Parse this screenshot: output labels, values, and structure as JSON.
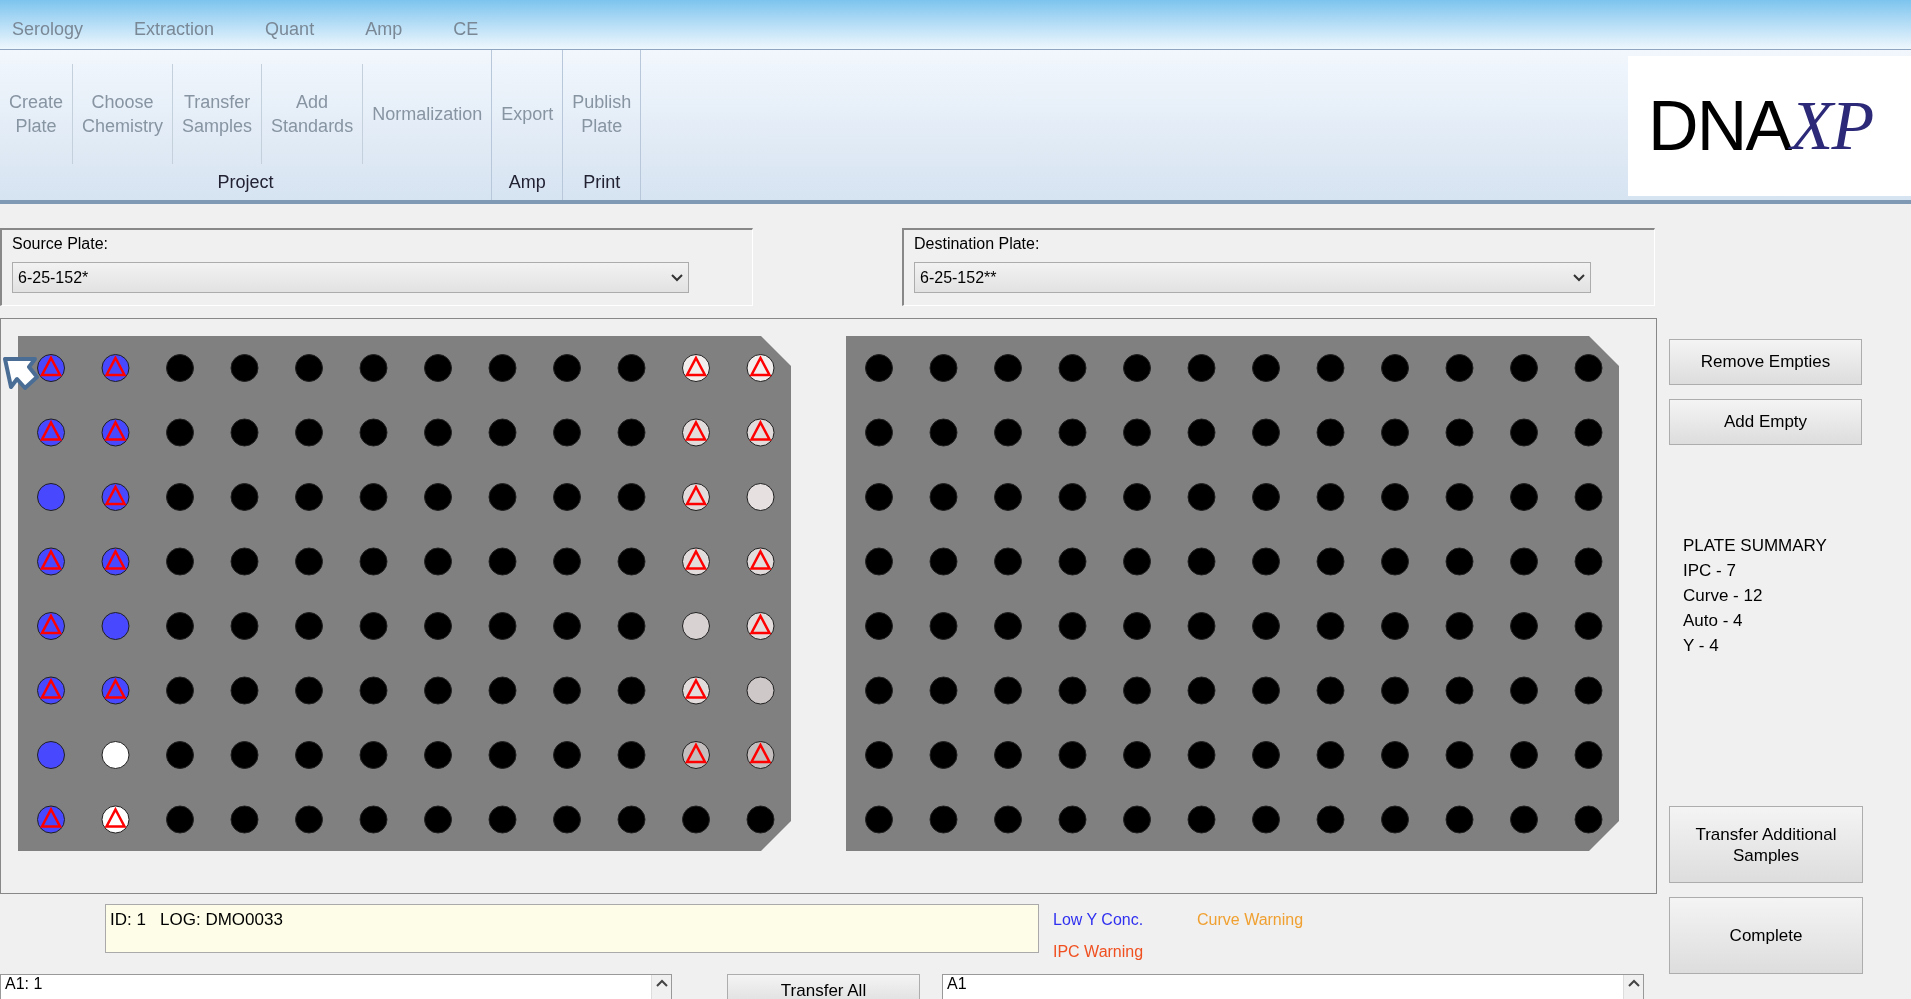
{
  "tabs": [
    {
      "label": "Serology"
    },
    {
      "label": "Extraction"
    },
    {
      "label": "Quant"
    },
    {
      "label": "Amp"
    },
    {
      "label": "CE"
    }
  ],
  "ribbon_groups": [
    {
      "label": "Project",
      "buttons": [
        [
          "Create",
          "Plate"
        ],
        [
          "Choose",
          "Chemistry"
        ],
        [
          "Transfer",
          "Samples"
        ],
        [
          "Add",
          "Standards"
        ],
        [
          "Normalization"
        ]
      ]
    },
    {
      "label": "Amp",
      "buttons": [
        [
          "Export"
        ]
      ]
    },
    {
      "label": "Print",
      "buttons": [
        [
          "Publish",
          "Plate"
        ]
      ]
    }
  ],
  "logo": {
    "main": "DNA",
    "accent": "XP"
  },
  "source_plate": {
    "label": "Source Plate:",
    "value": "6-25-152*",
    "rows": [
      [
        {
          "color": "#4848ff",
          "flag": true
        },
        {
          "color": "#4848ff",
          "flag": true
        },
        {
          "color": "#000000",
          "flag": false
        },
        {
          "color": "#000000",
          "flag": false
        },
        {
          "color": "#000000",
          "flag": false
        },
        {
          "color": "#000000",
          "flag": false
        },
        {
          "color": "#000000",
          "flag": false
        },
        {
          "color": "#000000",
          "flag": false
        },
        {
          "color": "#000000",
          "flag": false
        },
        {
          "color": "#000000",
          "flag": false
        },
        {
          "color": "#f2eeee",
          "flag": true
        },
        {
          "color": "#f2eeee",
          "flag": true
        }
      ],
      [
        {
          "color": "#4848ff",
          "flag": true
        },
        {
          "color": "#4848ff",
          "flag": true
        },
        {
          "color": "#000000",
          "flag": false
        },
        {
          "color": "#000000",
          "flag": false
        },
        {
          "color": "#000000",
          "flag": false
        },
        {
          "color": "#000000",
          "flag": false
        },
        {
          "color": "#000000",
          "flag": false
        },
        {
          "color": "#000000",
          "flag": false
        },
        {
          "color": "#000000",
          "flag": false
        },
        {
          "color": "#000000",
          "flag": false
        },
        {
          "color": "#e2dcdc",
          "flag": true
        },
        {
          "color": "#e2dcdc",
          "flag": true
        }
      ],
      [
        {
          "color": "#4848ff",
          "flag": false
        },
        {
          "color": "#4848ff",
          "flag": true
        },
        {
          "color": "#000000",
          "flag": false
        },
        {
          "color": "#000000",
          "flag": false
        },
        {
          "color": "#000000",
          "flag": false
        },
        {
          "color": "#000000",
          "flag": false
        },
        {
          "color": "#000000",
          "flag": false
        },
        {
          "color": "#000000",
          "flag": false
        },
        {
          "color": "#000000",
          "flag": false
        },
        {
          "color": "#000000",
          "flag": false
        },
        {
          "color": "#e2dcdc",
          "flag": true
        },
        {
          "color": "#e6e0e0",
          "flag": false
        }
      ],
      [
        {
          "color": "#4848ff",
          "flag": true
        },
        {
          "color": "#4848ff",
          "flag": true
        },
        {
          "color": "#000000",
          "flag": false
        },
        {
          "color": "#000000",
          "flag": false
        },
        {
          "color": "#000000",
          "flag": false
        },
        {
          "color": "#000000",
          "flag": false
        },
        {
          "color": "#000000",
          "flag": false
        },
        {
          "color": "#000000",
          "flag": false
        },
        {
          "color": "#000000",
          "flag": false
        },
        {
          "color": "#000000",
          "flag": false
        },
        {
          "color": "#e2dcdc",
          "flag": true
        },
        {
          "color": "#e2dcdc",
          "flag": true
        }
      ],
      [
        {
          "color": "#4848ff",
          "flag": true
        },
        {
          "color": "#4848ff",
          "flag": false
        },
        {
          "color": "#000000",
          "flag": false
        },
        {
          "color": "#000000",
          "flag": false
        },
        {
          "color": "#000000",
          "flag": false
        },
        {
          "color": "#000000",
          "flag": false
        },
        {
          "color": "#000000",
          "flag": false
        },
        {
          "color": "#000000",
          "flag": false
        },
        {
          "color": "#000000",
          "flag": false
        },
        {
          "color": "#000000",
          "flag": false
        },
        {
          "color": "#d8d2d2",
          "flag": false
        },
        {
          "color": "#e2dcdc",
          "flag": true
        }
      ],
      [
        {
          "color": "#4848ff",
          "flag": true
        },
        {
          "color": "#4848ff",
          "flag": true
        },
        {
          "color": "#000000",
          "flag": false
        },
        {
          "color": "#000000",
          "flag": false
        },
        {
          "color": "#000000",
          "flag": false
        },
        {
          "color": "#000000",
          "flag": false
        },
        {
          "color": "#000000",
          "flag": false
        },
        {
          "color": "#000000",
          "flag": false
        },
        {
          "color": "#000000",
          "flag": false
        },
        {
          "color": "#000000",
          "flag": false
        },
        {
          "color": "#e2dcdc",
          "flag": true
        },
        {
          "color": "#cec8c8",
          "flag": false
        }
      ],
      [
        {
          "color": "#4848ff",
          "flag": false
        },
        {
          "color": "#ffffff",
          "flag": false
        },
        {
          "color": "#000000",
          "flag": false
        },
        {
          "color": "#000000",
          "flag": false
        },
        {
          "color": "#000000",
          "flag": false
        },
        {
          "color": "#000000",
          "flag": false
        },
        {
          "color": "#000000",
          "flag": false
        },
        {
          "color": "#000000",
          "flag": false
        },
        {
          "color": "#000000",
          "flag": false
        },
        {
          "color": "#000000",
          "flag": false
        },
        {
          "color": "#c4bebe",
          "flag": true
        },
        {
          "color": "#c4bebe",
          "flag": true
        }
      ],
      [
        {
          "color": "#4848ff",
          "flag": true
        },
        {
          "color": "#ffffff",
          "flag": true
        },
        {
          "color": "#000000",
          "flag": false
        },
        {
          "color": "#000000",
          "flag": false
        },
        {
          "color": "#000000",
          "flag": false
        },
        {
          "color": "#000000",
          "flag": false
        },
        {
          "color": "#000000",
          "flag": false
        },
        {
          "color": "#000000",
          "flag": false
        },
        {
          "color": "#000000",
          "flag": false
        },
        {
          "color": "#000000",
          "flag": false
        },
        {
          "color": "#000000",
          "flag": false
        },
        {
          "color": "#000000",
          "flag": false
        }
      ]
    ]
  },
  "destination_plate": {
    "label": "Destination Plate:",
    "value": "6-25-152**",
    "rows": [
      [
        {
          "color": "#000000",
          "flag": false
        },
        {
          "color": "#000000",
          "flag": false
        },
        {
          "color": "#000000",
          "flag": false
        },
        {
          "color": "#000000",
          "flag": false
        },
        {
          "color": "#000000",
          "flag": false
        },
        {
          "color": "#000000",
          "flag": false
        },
        {
          "color": "#000000",
          "flag": false
        },
        {
          "color": "#000000",
          "flag": false
        },
        {
          "color": "#000000",
          "flag": false
        },
        {
          "color": "#000000",
          "flag": false
        },
        {
          "color": "#000000",
          "flag": false
        },
        {
          "color": "#000000",
          "flag": false
        }
      ],
      [
        {
          "color": "#000000",
          "flag": false
        },
        {
          "color": "#000000",
          "flag": false
        },
        {
          "color": "#000000",
          "flag": false
        },
        {
          "color": "#000000",
          "flag": false
        },
        {
          "color": "#000000",
          "flag": false
        },
        {
          "color": "#000000",
          "flag": false
        },
        {
          "color": "#000000",
          "flag": false
        },
        {
          "color": "#000000",
          "flag": false
        },
        {
          "color": "#000000",
          "flag": false
        },
        {
          "color": "#000000",
          "flag": false
        },
        {
          "color": "#000000",
          "flag": false
        },
        {
          "color": "#000000",
          "flag": false
        }
      ],
      [
        {
          "color": "#000000",
          "flag": false
        },
        {
          "color": "#000000",
          "flag": false
        },
        {
          "color": "#000000",
          "flag": false
        },
        {
          "color": "#000000",
          "flag": false
        },
        {
          "color": "#000000",
          "flag": false
        },
        {
          "color": "#000000",
          "flag": false
        },
        {
          "color": "#000000",
          "flag": false
        },
        {
          "color": "#000000",
          "flag": false
        },
        {
          "color": "#000000",
          "flag": false
        },
        {
          "color": "#000000",
          "flag": false
        },
        {
          "color": "#000000",
          "flag": false
        },
        {
          "color": "#000000",
          "flag": false
        }
      ],
      [
        {
          "color": "#000000",
          "flag": false
        },
        {
          "color": "#000000",
          "flag": false
        },
        {
          "color": "#000000",
          "flag": false
        },
        {
          "color": "#000000",
          "flag": false
        },
        {
          "color": "#000000",
          "flag": false
        },
        {
          "color": "#000000",
          "flag": false
        },
        {
          "color": "#000000",
          "flag": false
        },
        {
          "color": "#000000",
          "flag": false
        },
        {
          "color": "#000000",
          "flag": false
        },
        {
          "color": "#000000",
          "flag": false
        },
        {
          "color": "#000000",
          "flag": false
        },
        {
          "color": "#000000",
          "flag": false
        }
      ],
      [
        {
          "color": "#000000",
          "flag": false
        },
        {
          "color": "#000000",
          "flag": false
        },
        {
          "color": "#000000",
          "flag": false
        },
        {
          "color": "#000000",
          "flag": false
        },
        {
          "color": "#000000",
          "flag": false
        },
        {
          "color": "#000000",
          "flag": false
        },
        {
          "color": "#000000",
          "flag": false
        },
        {
          "color": "#000000",
          "flag": false
        },
        {
          "color": "#000000",
          "flag": false
        },
        {
          "color": "#000000",
          "flag": false
        },
        {
          "color": "#000000",
          "flag": false
        },
        {
          "color": "#000000",
          "flag": false
        }
      ],
      [
        {
          "color": "#000000",
          "flag": false
        },
        {
          "color": "#000000",
          "flag": false
        },
        {
          "color": "#000000",
          "flag": false
        },
        {
          "color": "#000000",
          "flag": false
        },
        {
          "color": "#000000",
          "flag": false
        },
        {
          "color": "#000000",
          "flag": false
        },
        {
          "color": "#000000",
          "flag": false
        },
        {
          "color": "#000000",
          "flag": false
        },
        {
          "color": "#000000",
          "flag": false
        },
        {
          "color": "#000000",
          "flag": false
        },
        {
          "color": "#000000",
          "flag": false
        },
        {
          "color": "#000000",
          "flag": false
        }
      ],
      [
        {
          "color": "#000000",
          "flag": false
        },
        {
          "color": "#000000",
          "flag": false
        },
        {
          "color": "#000000",
          "flag": false
        },
        {
          "color": "#000000",
          "flag": false
        },
        {
          "color": "#000000",
          "flag": false
        },
        {
          "color": "#000000",
          "flag": false
        },
        {
          "color": "#000000",
          "flag": false
        },
        {
          "color": "#000000",
          "flag": false
        },
        {
          "color": "#000000",
          "flag": false
        },
        {
          "color": "#000000",
          "flag": false
        },
        {
          "color": "#000000",
          "flag": false
        },
        {
          "color": "#000000",
          "flag": false
        }
      ],
      [
        {
          "color": "#000000",
          "flag": false
        },
        {
          "color": "#000000",
          "flag": false
        },
        {
          "color": "#000000",
          "flag": false
        },
        {
          "color": "#000000",
          "flag": false
        },
        {
          "color": "#000000",
          "flag": false
        },
        {
          "color": "#000000",
          "flag": false
        },
        {
          "color": "#000000",
          "flag": false
        },
        {
          "color": "#000000",
          "flag": false
        },
        {
          "color": "#000000",
          "flag": false
        },
        {
          "color": "#000000",
          "flag": false
        },
        {
          "color": "#000000",
          "flag": false
        },
        {
          "color": "#000000",
          "flag": false
        }
      ]
    ]
  },
  "side_buttons": [
    "Remove Empties",
    "Add Empty"
  ],
  "plate_summary": [
    "PLATE SUMMARY",
    "IPC - 7",
    "Curve - 12",
    "Auto - 4",
    "Y - 4"
  ],
  "action_buttons": [
    "Transfer Additional Samples",
    "Complete"
  ],
  "log": {
    "value": "ID: 1   LOG: DMO0033"
  },
  "legend": [
    {
      "label": "Low Y Conc.",
      "color": "#3030f0"
    },
    {
      "label": "Curve Warning",
      "color": "#f0a030"
    },
    {
      "label": "IPC Warning",
      "color": "#f05020"
    }
  ],
  "source_list": [
    "A1: 1"
  ],
  "transfer_button": "Transfer All",
  "destination_list": [
    "A1"
  ]
}
